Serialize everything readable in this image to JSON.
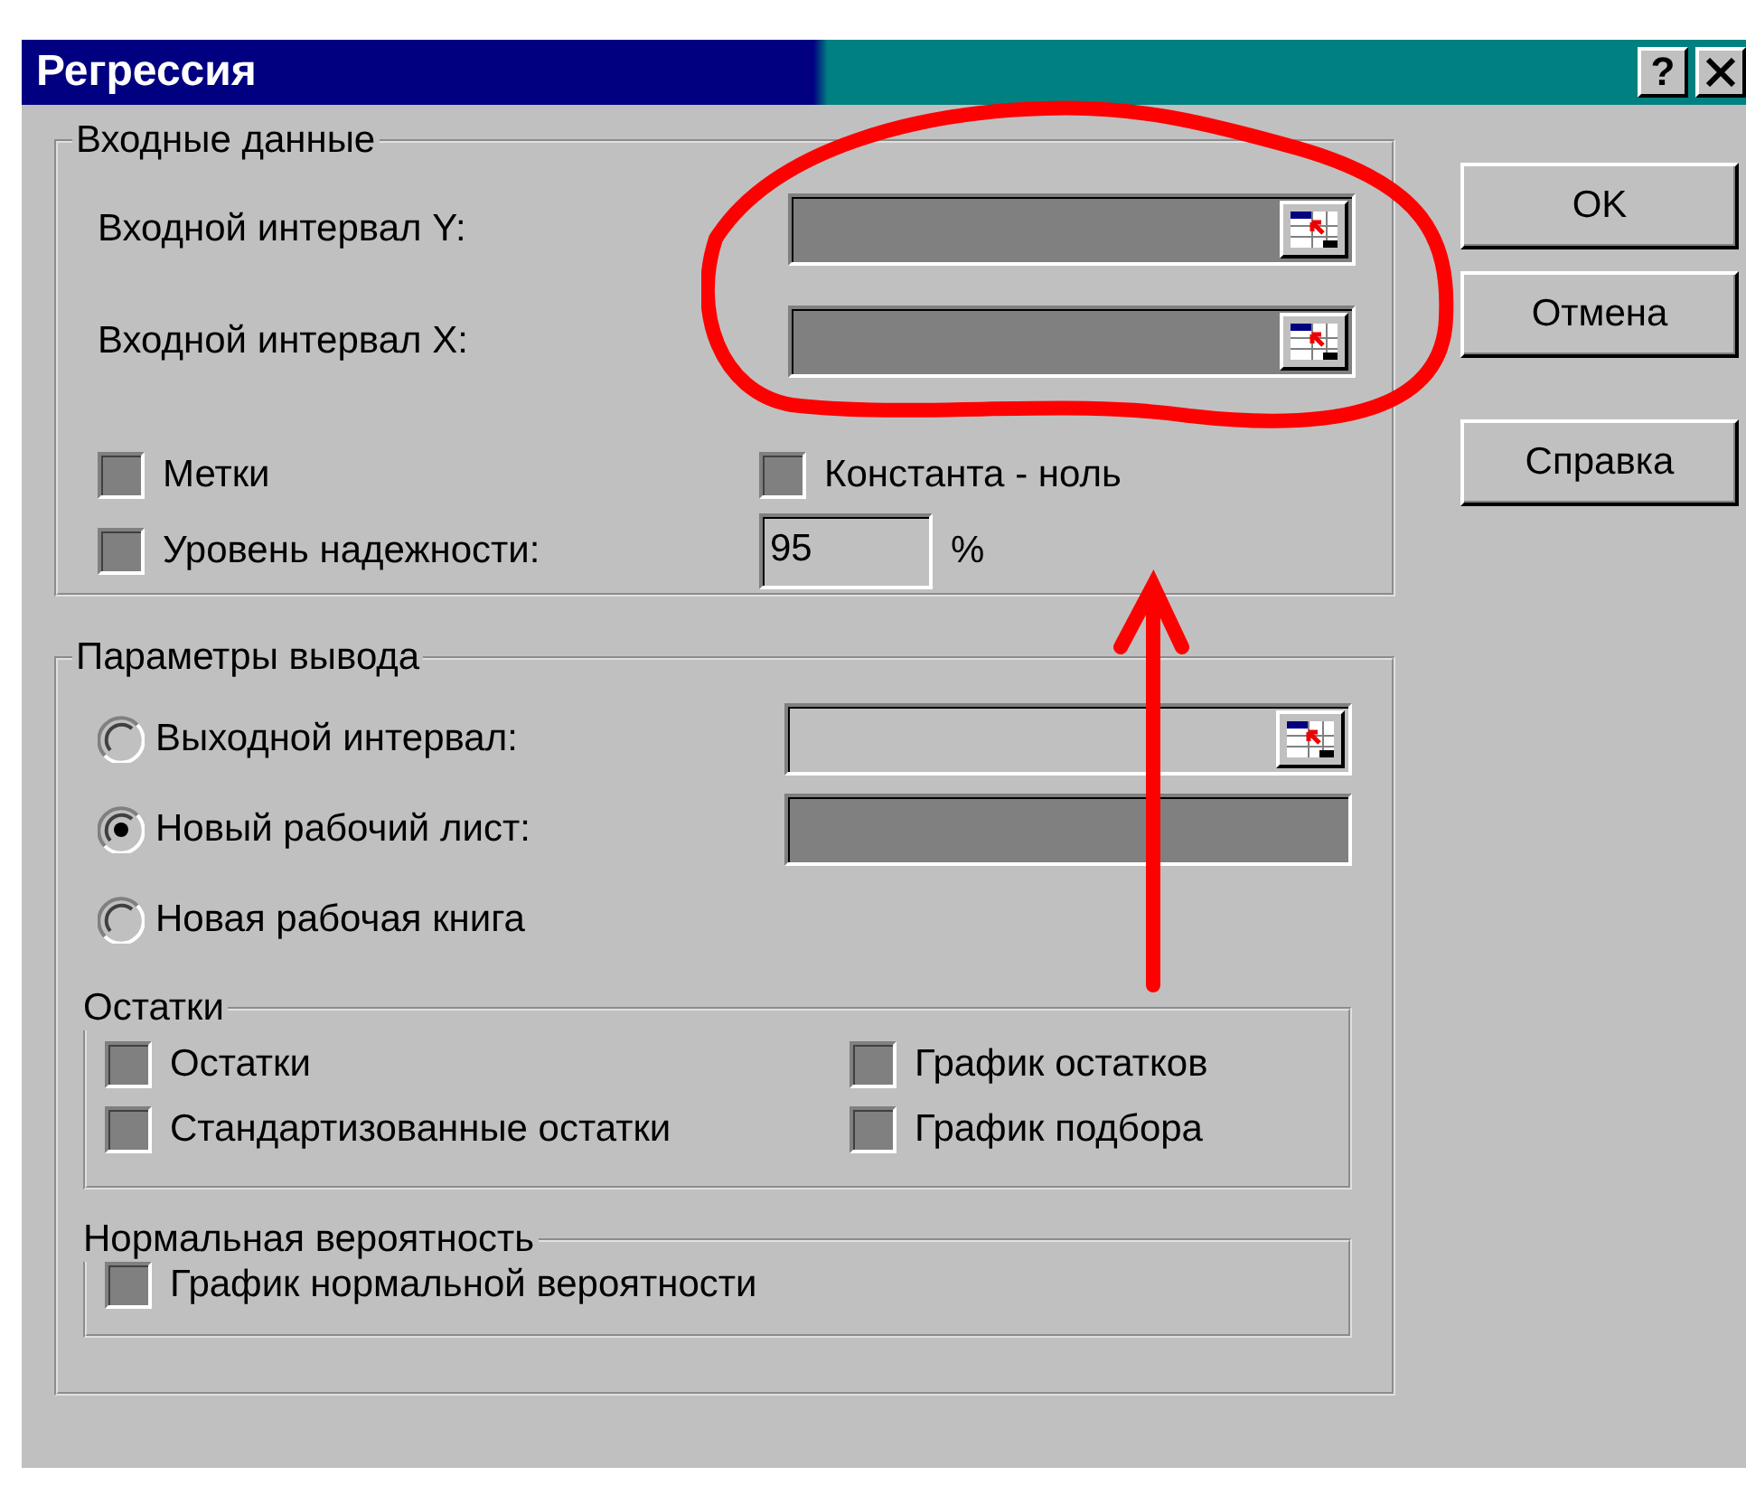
{
  "window": {
    "title": "Регрессия",
    "help_button": "?"
  },
  "buttons": [
    {
      "label": "OK"
    },
    {
      "label": "Отмена"
    },
    {
      "label": "Справка"
    }
  ],
  "input_group": {
    "title": "Входные данные",
    "ranges": [
      {
        "label": "Входной интервал Y:",
        "disabled": true
      },
      {
        "label": "Входной интервал X:",
        "disabled": true
      }
    ],
    "options": [
      {
        "label": "Метки",
        "checked": false,
        "disabled": true
      },
      {
        "label": "Константа - ноль",
        "checked": false,
        "disabled": true
      }
    ],
    "confidence": {
      "label": "Уровень надежности:",
      "checked": false,
      "disabled": true,
      "value": "95",
      "unit": "%"
    }
  },
  "output_group": {
    "title": "Параметры вывода",
    "options": [
      {
        "label": "Выходной интервал:",
        "selected": false,
        "field": {
          "kind": "range",
          "disabled": false
        }
      },
      {
        "label": "Новый рабочий лист:",
        "selected": true,
        "field": {
          "kind": "text",
          "disabled": true
        }
      },
      {
        "label": "Новая рабочая книга",
        "selected": false
      }
    ],
    "residuals": {
      "title": "Остатки",
      "options": [
        {
          "label": "Остатки",
          "checked": false,
          "disabled": true
        },
        {
          "label": "График остатков",
          "checked": false,
          "disabled": true
        },
        {
          "label": "Стандартизованные остатки",
          "checked": false,
          "disabled": true
        },
        {
          "label": "График подбора",
          "checked": false,
          "disabled": true
        }
      ]
    },
    "normal": {
      "title": "Нормальная вероятность",
      "options": [
        {
          "label": "График нормальной вероятности",
          "checked": false,
          "disabled": true
        }
      ]
    }
  }
}
